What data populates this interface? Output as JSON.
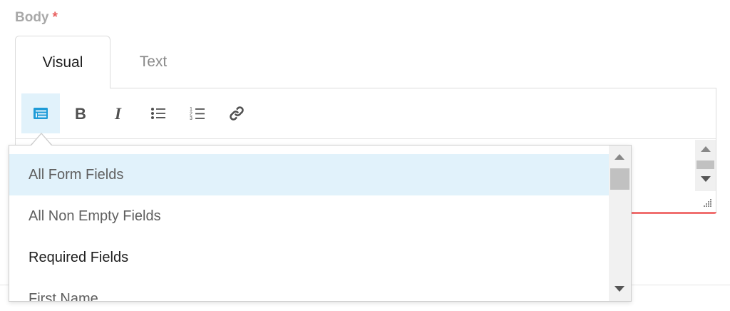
{
  "field": {
    "label": "Body",
    "required_mark": "*"
  },
  "tabs": [
    {
      "label": "Visual",
      "active": true
    },
    {
      "label": "Text",
      "active": false
    }
  ],
  "toolbar": {
    "buttons": [
      {
        "icon": "form-fields-icon",
        "active": true
      },
      {
        "icon": "bold-icon"
      },
      {
        "icon": "italic-icon"
      },
      {
        "icon": "bullet-list-icon"
      },
      {
        "icon": "numbered-list-icon"
      },
      {
        "icon": "link-icon"
      }
    ]
  },
  "dropdown": {
    "items": [
      {
        "label": "All Form Fields",
        "highlighted": true
      },
      {
        "label": "All Non Empty Fields"
      },
      {
        "label": "Required Fields"
      },
      {
        "label": "First Name"
      }
    ]
  },
  "colors": {
    "accent": "#1e9bd7",
    "highlight": "#e1f2fb",
    "required": "#e8605f",
    "error_border": "#f07070"
  }
}
